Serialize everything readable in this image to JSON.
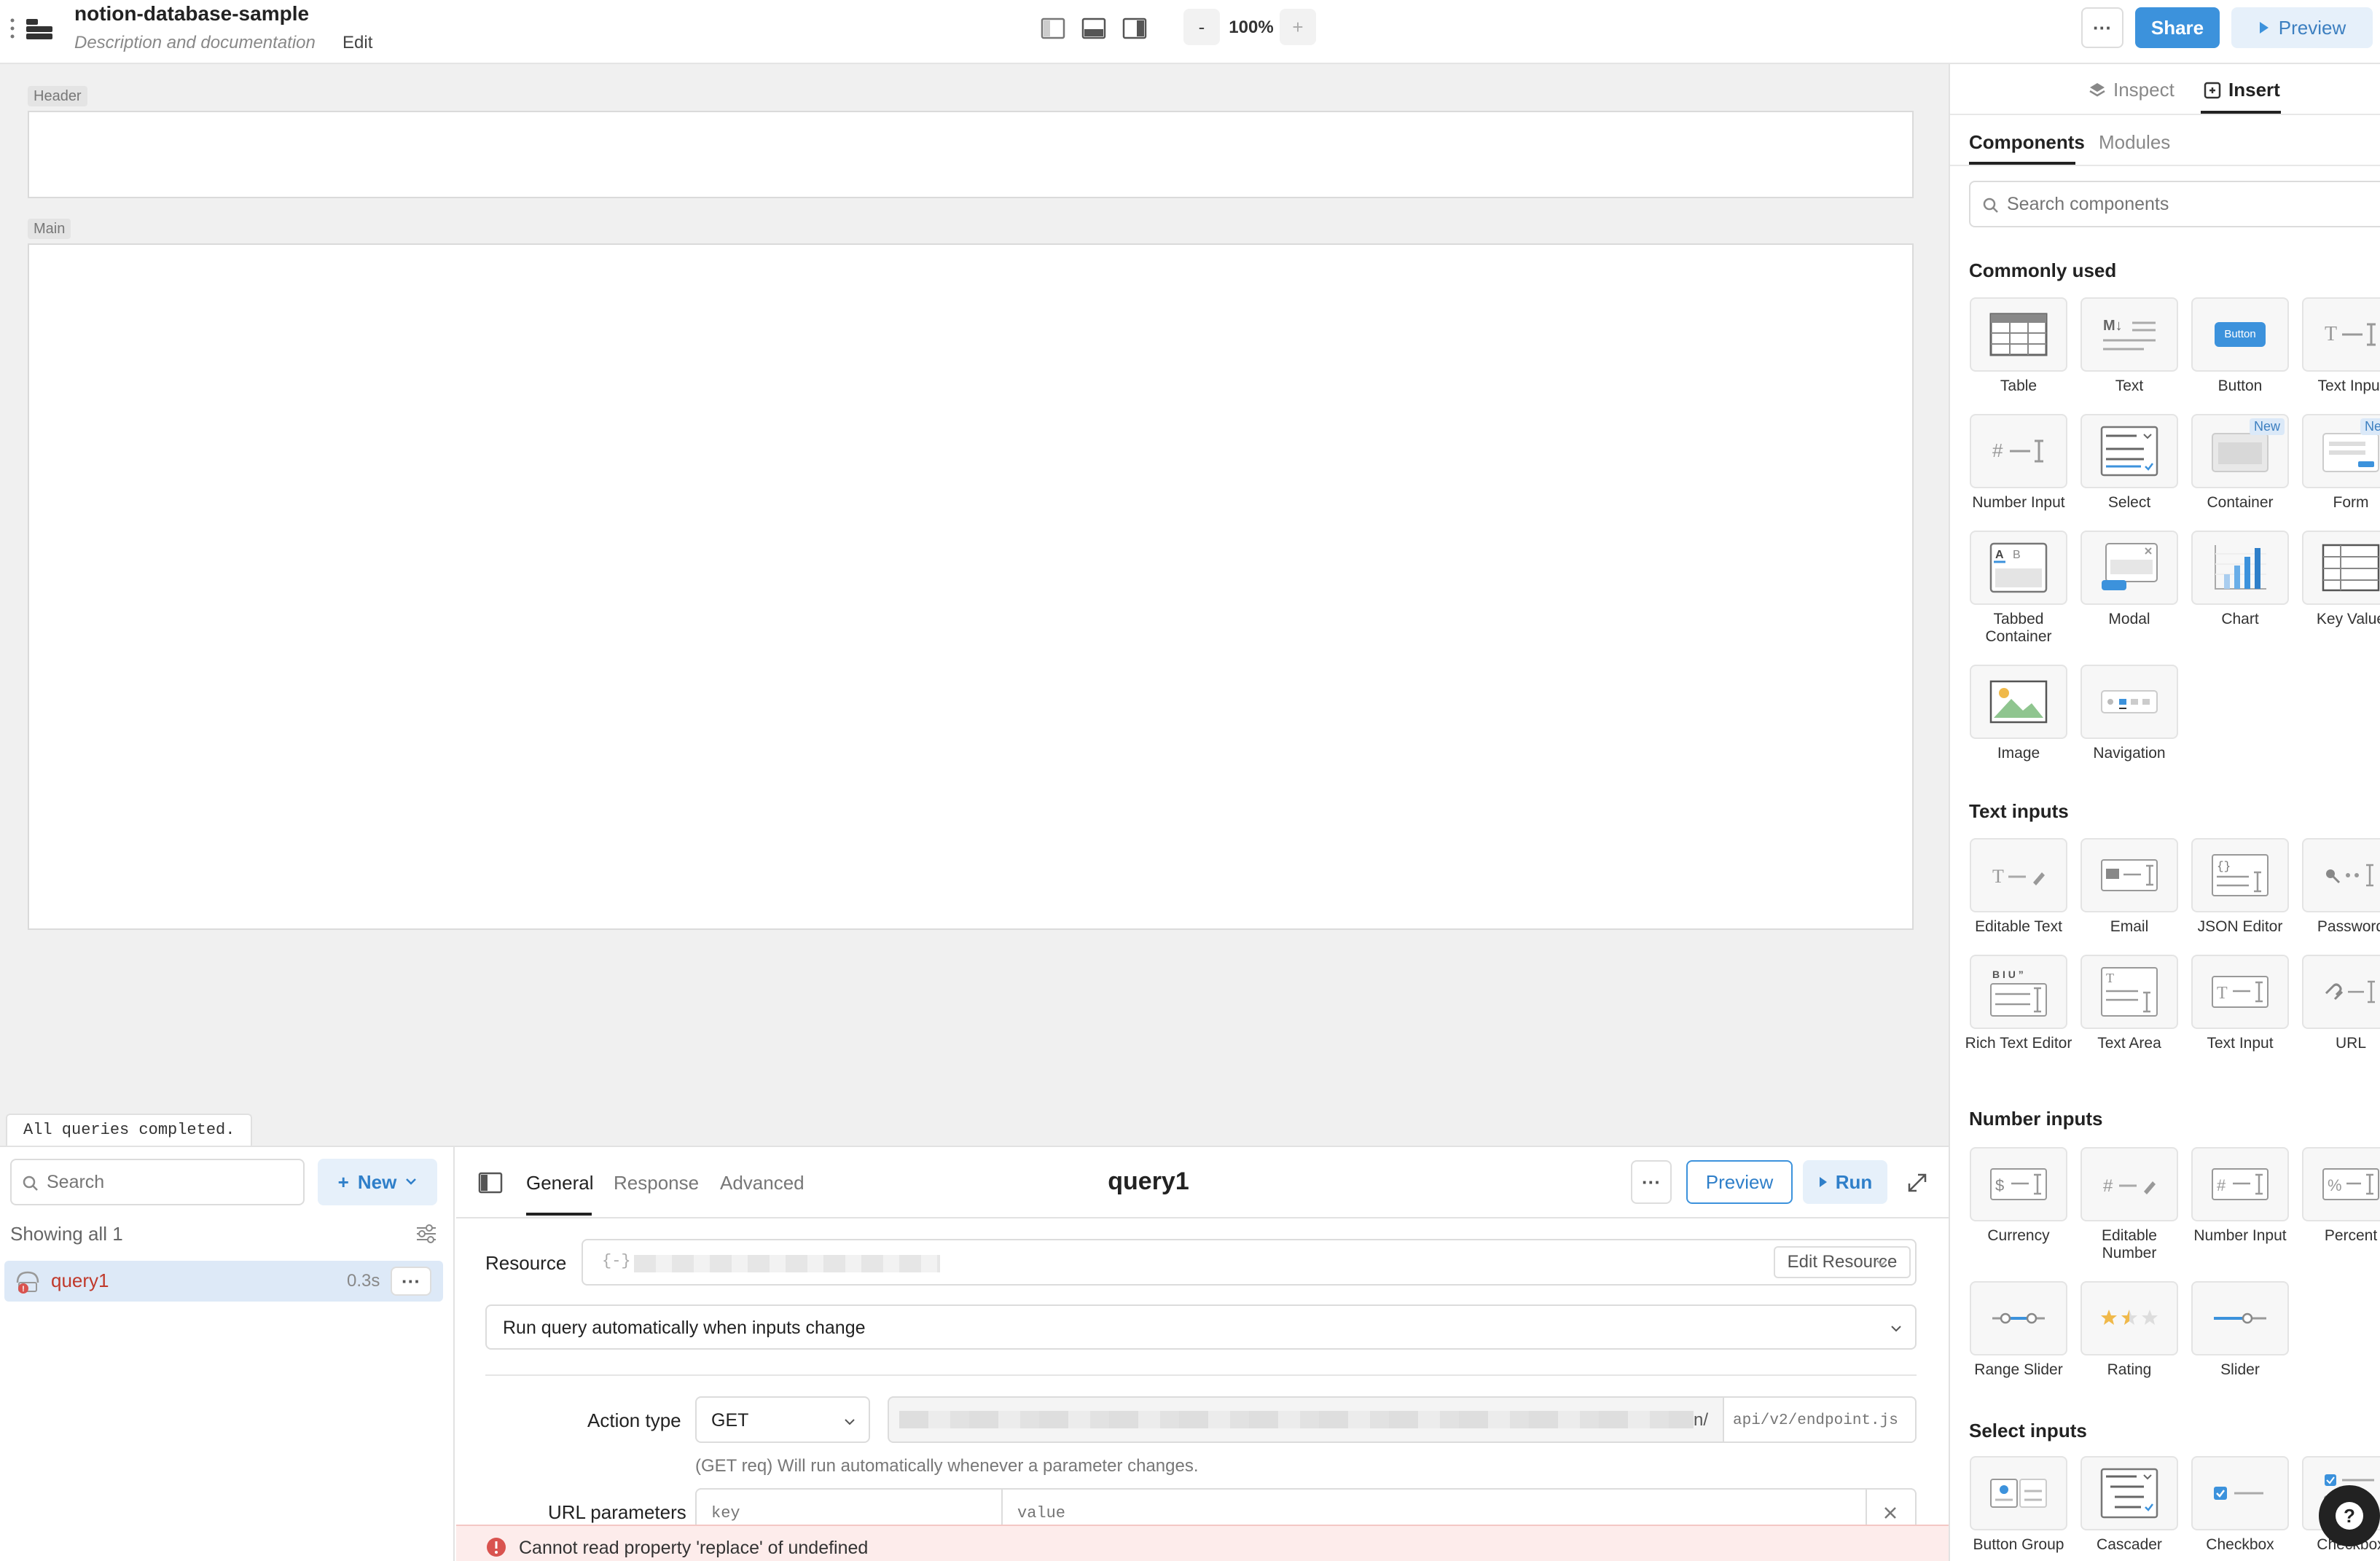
{
  "app": {
    "title": "notion-database-sample",
    "subtitle": "Description and documentation",
    "edit_label": "Edit",
    "zoom_minus": "-",
    "zoom_level": "100%",
    "zoom_plus": "+",
    "more_label": "···",
    "share_label": "Share",
    "preview_label": "Preview"
  },
  "canvas": {
    "header_tag": "Header",
    "main_tag": "Main",
    "status_text": "All queries completed."
  },
  "right_panel": {
    "tabs": [
      "Inspect",
      "Insert"
    ],
    "active_tab": "Insert",
    "subtabs": [
      "Components",
      "Modules"
    ],
    "search_placeholder": "Search components",
    "sections": [
      {
        "title": "Commonly used",
        "items": [
          "Table",
          "Text",
          "Button",
          "Text Input",
          "Number Input",
          "Select",
          "Container",
          "Form",
          "Tabbed Container",
          "Modal",
          "Chart",
          "Key Value",
          "Image",
          "Navigation"
        ]
      },
      {
        "title": "Text inputs",
        "items": [
          "Editable Text",
          "Email",
          "JSON Editor",
          "Password",
          "Rich Text Editor",
          "Text Area",
          "Text Input",
          "URL"
        ]
      },
      {
        "title": "Number inputs",
        "items": [
          "Currency",
          "Editable Number",
          "Number Input",
          "Percent",
          "Range Slider",
          "Rating",
          "Slider"
        ]
      },
      {
        "title": "Select inputs",
        "items": [
          "Button Group",
          "Cascader",
          "Checkbox",
          "Checkbox"
        ]
      }
    ],
    "badge_new": "New",
    "button_tile_text": "Button"
  },
  "query_list": {
    "search_placeholder": "Search",
    "new_label": "New",
    "showing_text": "Showing all 1",
    "queries": [
      {
        "name": "query1",
        "time": "0.3s"
      }
    ]
  },
  "editor": {
    "tabs": [
      "General",
      "Response",
      "Advanced"
    ],
    "active_tab": "General",
    "query_name": "query1",
    "preview_label": "Preview",
    "run_label": "Run",
    "resource_label": "Resource",
    "resource_placeholder": "{-}",
    "edit_resource_label": "Edit Resource",
    "trigger_value": "Run query automatically when inputs change",
    "action_type_label": "Action type",
    "method_value": "GET",
    "url_suffix": "n/",
    "endpoint_placeholder": "api/v2/endpoint.js",
    "hint_text": "(GET req) Will run automatically whenever a parameter changes.",
    "url_params_label": "URL parameters",
    "key_placeholder": "key",
    "value_placeholder": "value",
    "error_text": "Cannot read property 'replace' of undefined"
  },
  "colors": {
    "primary": "#3c92dc",
    "primary_dark": "#2f7fc9",
    "error": "#d9534f",
    "error_bg": "#fdeceb",
    "selected_row": "#dde9f7"
  }
}
